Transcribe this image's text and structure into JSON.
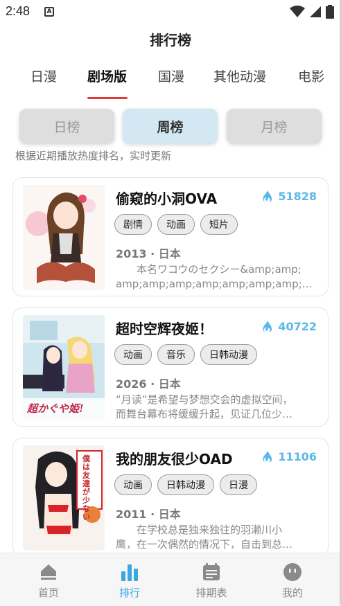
{
  "status_bar": {
    "time": "2:48",
    "notification_badge": "A"
  },
  "page_title": "排行榜",
  "tabs": [
    {
      "label": "日漫",
      "active": false
    },
    {
      "label": "剧场版",
      "active": true
    },
    {
      "label": "国漫",
      "active": false
    },
    {
      "label": "其他动漫",
      "active": false
    },
    {
      "label": "电影",
      "active": false
    }
  ],
  "ranking_period": {
    "day": "日榜",
    "week": "周榜",
    "month": "月榜",
    "selected": "周榜"
  },
  "subtitle": "根据近期播放热度排名，实时更新",
  "items": [
    {
      "title": "偷窥的小洞OVA",
      "heat": "51828",
      "tags": [
        "剧情",
        "动画",
        "短片"
      ],
      "meta": "2013 · 日本",
      "desc_line1": "　　本名ワコウのセクシー&amp;amp;",
      "desc_line2": "amp;amp;amp;amp;amp;amp;amp;amp;amp;a…"
    },
    {
      "title": "超时空辉夜姬！",
      "heat": "40722",
      "tags": [
        "动画",
        "音乐",
        "日韩动漫"
      ],
      "meta": "2026 · 日本",
      "desc_line1": "“月读”是希望与梦想交会的虚拟空间，",
      "desc_line2": "而舞台幕布将缓缓升起，见证几位少…",
      "cover_text": "超かぐや姫!"
    },
    {
      "title": "我的朋友很少OAD",
      "heat": "11106",
      "tags": [
        "动画",
        "日韩动漫",
        "日漫"
      ],
      "meta": "2011 · 日本",
      "desc_line1": "　　在学校总是独来独往的羽濑川小",
      "desc_line2": "鹰，在一次偶然的情况下，自击到总…",
      "cover_text": "僕は友達が少ない"
    }
  ],
  "bottom_nav": [
    {
      "label": "首页",
      "icon": "home-icon",
      "active": false
    },
    {
      "label": "排行",
      "icon": "bar-chart-icon",
      "active": true
    },
    {
      "label": "排期表",
      "icon": "calendar-icon",
      "active": false
    },
    {
      "label": "我的",
      "icon": "profile-icon",
      "active": false
    }
  ],
  "colors": {
    "accent": "#3aa7e0",
    "tab_indicator": "#e53935",
    "heat": "#5ab8e8"
  }
}
